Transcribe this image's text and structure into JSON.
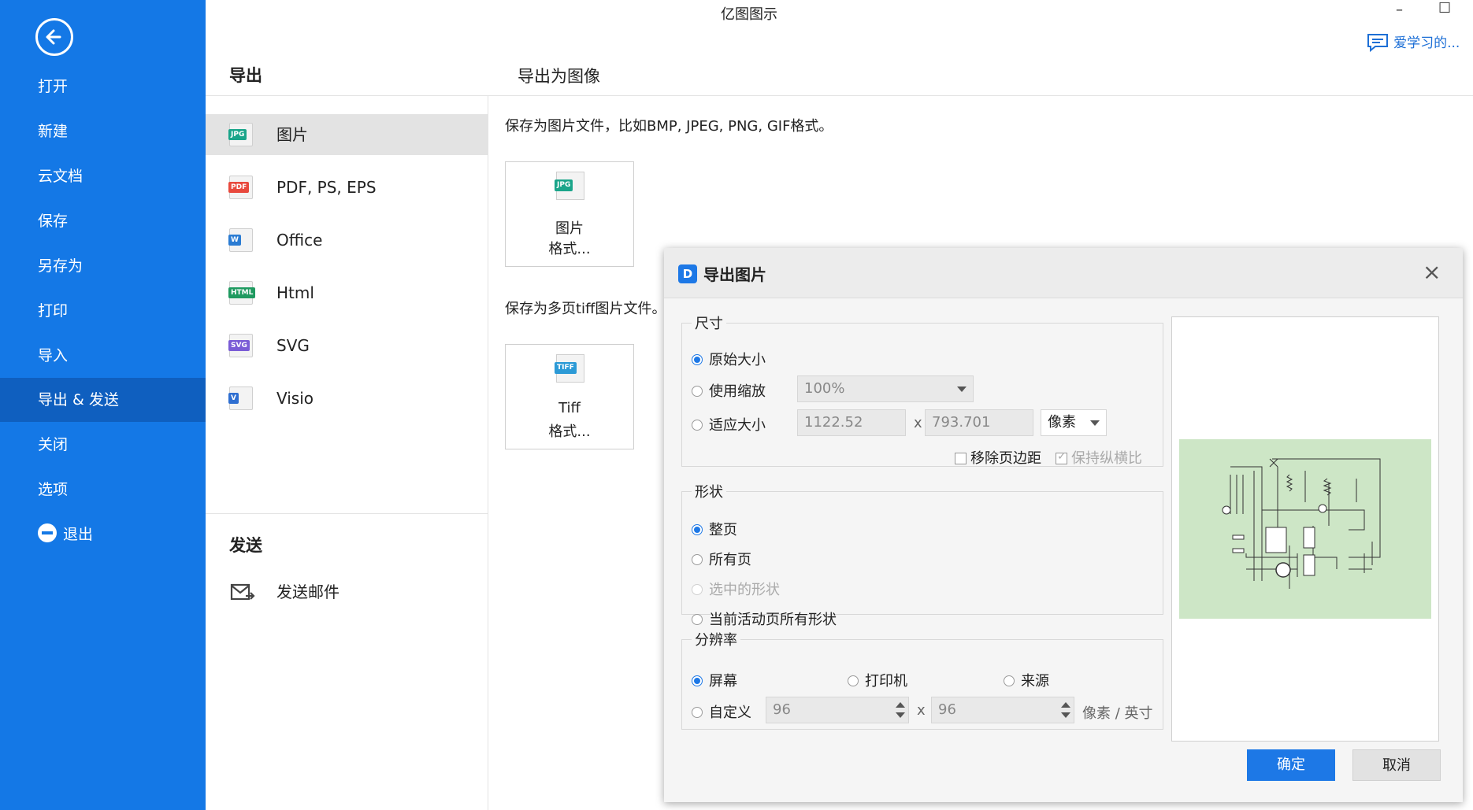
{
  "app": {
    "title": "亿图图示",
    "help_text": "爱学习的..."
  },
  "sidebar": {
    "items": [
      {
        "label": "打开"
      },
      {
        "label": "新建"
      },
      {
        "label": "云文档"
      },
      {
        "label": "保存"
      },
      {
        "label": "另存为"
      },
      {
        "label": "打印"
      },
      {
        "label": "导入"
      },
      {
        "label": "导出 & 发送",
        "active": true
      },
      {
        "label": "关闭"
      },
      {
        "label": "选项"
      },
      {
        "label": "退出"
      }
    ]
  },
  "export_section": {
    "title": "导出",
    "items": [
      {
        "label": "图片",
        "icon": "JPG",
        "color": "#1aa58a"
      },
      {
        "label": "PDF, PS, EPS",
        "icon": "PDF",
        "color": "#e8493d"
      },
      {
        "label": "Office",
        "icon": "W",
        "color": "#2b7cd3"
      },
      {
        "label": "Html",
        "icon": "HTML",
        "color": "#1f9a60"
      },
      {
        "label": "SVG",
        "icon": "SVG",
        "color": "#7a5cd6"
      },
      {
        "label": "Visio",
        "icon": "V",
        "color": "#2f6fd1"
      }
    ]
  },
  "send_section": {
    "title": "发送",
    "email_label": "发送邮件"
  },
  "main": {
    "title": "导出为图像",
    "image_desc": "保存为图片文件，比如BMP, JPEG, PNG, GIF格式。",
    "image_card": {
      "icon": "JPG",
      "line1": "图片",
      "line2": "格式..."
    },
    "tiff_desc": "保存为多页tiff图片文件。",
    "tiff_card": {
      "icon": "TIFF",
      "line1": "Tiff",
      "line2": "格式..."
    }
  },
  "dialog": {
    "title": "导出图片",
    "size_group": {
      "label": "尺寸",
      "original": "原始大小",
      "scale": "使用缩放",
      "scale_value": "100%",
      "fit": "适应大小",
      "width": "1122.52",
      "x": "x",
      "height": "793.701",
      "unit": "像素",
      "remove_margin": "移除页边距",
      "keep_ratio": "保持纵横比"
    },
    "shape_group": {
      "label": "形状",
      "whole_page": "整页",
      "all_pages": "所有页",
      "selected": "选中的形状",
      "active_page_shapes": "当前活动页所有形状"
    },
    "resolution_group": {
      "label": "分辨率",
      "screen": "屏幕",
      "printer": "打印机",
      "source": "来源",
      "custom": "自定义",
      "dpi_x": "96",
      "x": "x",
      "dpi_y": "96",
      "unit": "像素 / 英寸"
    },
    "ok": "确定",
    "cancel": "取消",
    "preview_bg": "#cde6c6"
  }
}
